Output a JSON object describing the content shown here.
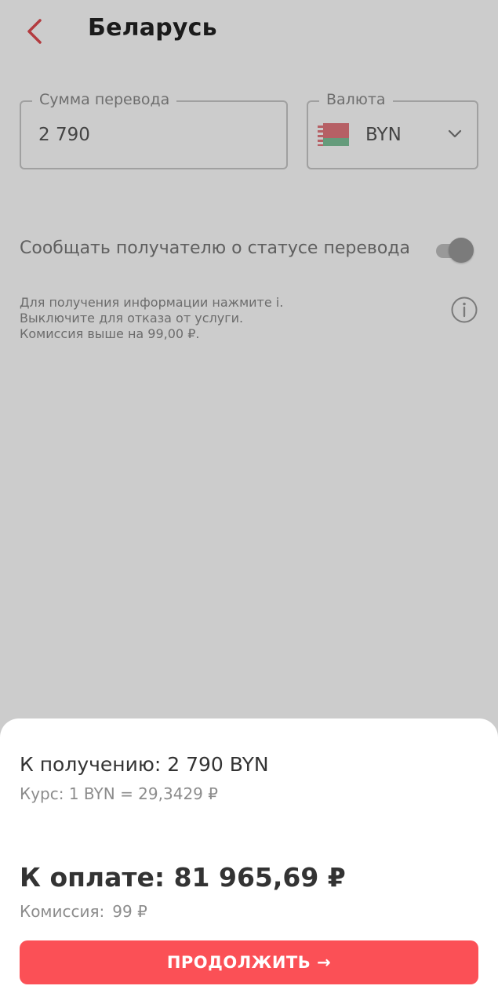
{
  "header": {
    "title": "Беларусь",
    "back_icon": "chevron-left-icon",
    "accent_color": "#e04a4f"
  },
  "transfer": {
    "amount_label": "Сумма перевода",
    "amount_value": "2 790",
    "currency_label": "Валюта",
    "currency_value": "BYN",
    "currency_flag": "belarus-flag-icon"
  },
  "notify": {
    "label": "Сообщать получателю о статусе перевода",
    "enabled": true,
    "info_lines": [
      "Для получения информации нажмите i.",
      "Выключите для отказа от услуги.",
      "Комиссия выше на 99,00 ₽."
    ],
    "info_icon": "info-icon"
  },
  "sheet": {
    "receive": "К получению: 2 790 BYN",
    "rate": "Курс: 1 BYN = 29,3429 ₽",
    "pay": "К оплате: 81 965,69 ₽",
    "commission_label": "Комиссия:",
    "commission_value": "99 ₽",
    "continue_label": "ПРОДОЛЖИТЬ →",
    "button_color": "#fb5056"
  }
}
